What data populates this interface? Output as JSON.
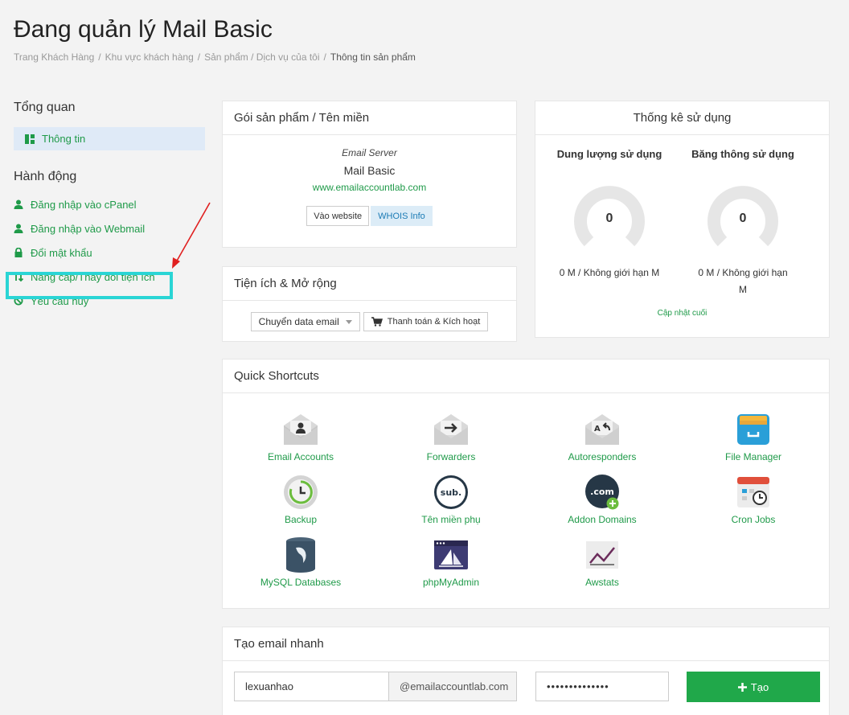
{
  "page": {
    "title": "Đang quản lý Mail Basic",
    "breadcrumb": [
      "Trang Khách Hàng",
      "Khu vực khách hàng",
      "Sản phẩm / Dịch vụ của tôi",
      "Thông tin sản phẩm"
    ]
  },
  "sidebar": {
    "overview_heading": "Tổng quan",
    "active_item": "Thông tin",
    "actions_heading": "Hành động",
    "actions": [
      {
        "label": "Đăng nhập vào cPanel",
        "icon": "user-icon"
      },
      {
        "label": "Đăng nhập vào Webmail",
        "icon": "user-icon"
      },
      {
        "label": "Đổi mật khẩu",
        "icon": "lock-icon"
      },
      {
        "label": "Nâng cấp/Thay đổi tiện ích",
        "icon": "swap-icon"
      },
      {
        "label": "Yêu cầu huỷ",
        "icon": "ban-icon"
      }
    ]
  },
  "package": {
    "heading": "Gói sản phẩm / Tên miền",
    "type": "Email Server",
    "name": "Mail Basic",
    "domain": "www.emailaccountlab.com",
    "visit_button": "Vào website",
    "whois_button": "WHOIS Info"
  },
  "extensions": {
    "heading": "Tiện ích & Mở rộng",
    "dropdown": "Chuyển data email",
    "pay_button": "Thanh toán & Kích hoạt"
  },
  "stats": {
    "heading": "Thống kê sử dụng",
    "disk": {
      "label": "Dung lượng sử dụng",
      "value": "0",
      "line1": "0 M / Không giới hạn M",
      "line2": ""
    },
    "bandwidth": {
      "label": "Băng thông sử dụng",
      "value": "0",
      "line1": "0 M / Không giới hạn",
      "line2": "M"
    },
    "updated": "Cập nhật cuối"
  },
  "shortcuts": {
    "heading": "Quick Shortcuts",
    "items": [
      {
        "label": "Email Accounts",
        "icon": "email-accounts-icon"
      },
      {
        "label": "Forwarders",
        "icon": "forwarders-icon"
      },
      {
        "label": "Autoresponders",
        "icon": "autoresponders-icon"
      },
      {
        "label": "File Manager",
        "icon": "file-manager-icon"
      },
      {
        "label": "Backup",
        "icon": "backup-icon"
      },
      {
        "label": "Tên miền phụ",
        "icon": "subdomain-icon"
      },
      {
        "label": "Addon Domains",
        "icon": "addon-domains-icon"
      },
      {
        "label": "Cron Jobs",
        "icon": "cron-jobs-icon"
      },
      {
        "label": "MySQL Databases",
        "icon": "mysql-icon"
      },
      {
        "label": "phpMyAdmin",
        "icon": "phpmyadmin-icon"
      },
      {
        "label": "Awstats",
        "icon": "awstats-icon"
      }
    ]
  },
  "quick_email": {
    "heading": "Tạo email nhanh",
    "username": "lexuanhao",
    "domain_suffix": "@emailaccountlab.com",
    "password": "••••••••••••••",
    "create_button": "Tạo"
  },
  "colors": {
    "accent_green": "#1f9a49",
    "highlight": "#2ad5d5",
    "arrow": "#e02020"
  }
}
